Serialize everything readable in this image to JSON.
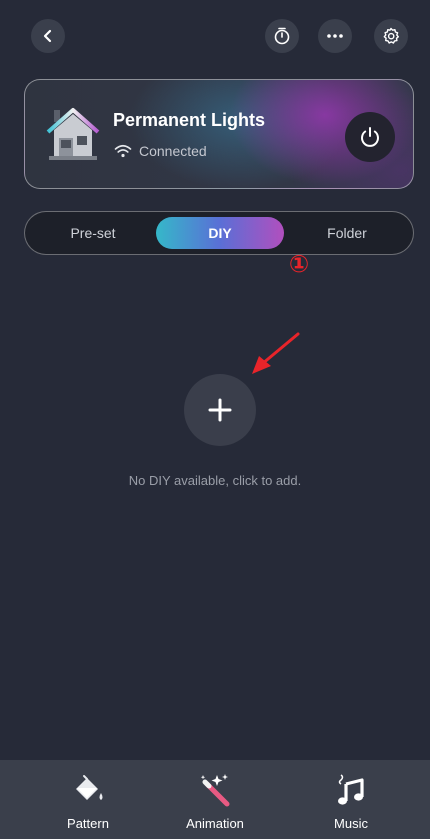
{
  "topbar": {
    "back_icon": "chevron-left-icon",
    "timer_icon": "timer-icon",
    "more_icon": "more-horizontal-icon",
    "settings_icon": "gear-icon"
  },
  "device": {
    "name": "Permanent Lights",
    "status": "Connected",
    "status_icon": "wifi-icon",
    "power_icon": "power-icon"
  },
  "tabs": [
    {
      "label": "Pre-set",
      "active": false
    },
    {
      "label": "DIY",
      "active": true
    },
    {
      "label": "Folder",
      "active": false
    }
  ],
  "main": {
    "add_icon": "plus-icon",
    "annotation_marker": "①",
    "empty_message": "No DIY available, click to add."
  },
  "bottom_nav": [
    {
      "label": "Pattern",
      "icon": "paint-bucket-icon"
    },
    {
      "label": "Animation",
      "icon": "magic-wand-icon"
    },
    {
      "label": "Music",
      "icon": "music-note-icon"
    }
  ],
  "colors": {
    "background": "#262a38",
    "accent_gradient": [
      "#35b8c9",
      "#5a6fd6",
      "#b14fbe"
    ],
    "annotation": "#e8242a"
  }
}
